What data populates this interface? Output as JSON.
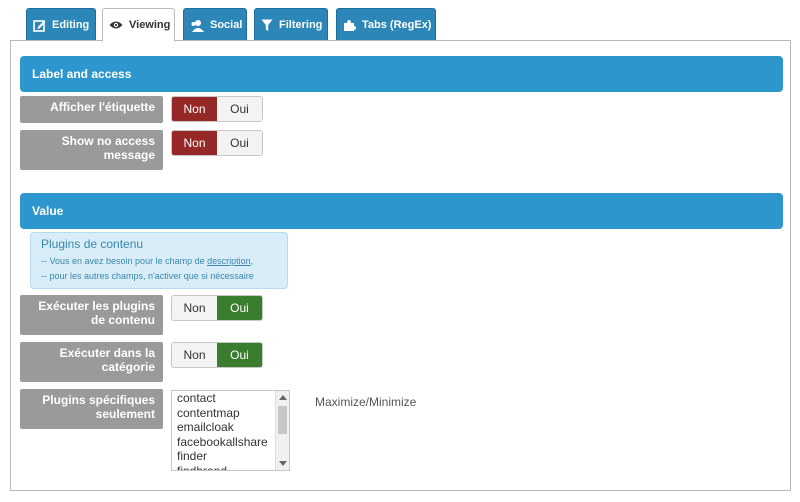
{
  "tabs": [
    {
      "label": "Editing",
      "icon": "edit-icon",
      "active": false
    },
    {
      "label": "Viewing",
      "icon": "eye-icon",
      "active": true
    },
    {
      "label": "Social",
      "icon": "users-icon",
      "active": false
    },
    {
      "label": "Filtering",
      "icon": "funnel-icon",
      "active": false
    },
    {
      "label": "Tabs (RegEx)",
      "icon": "puzzle-icon",
      "active": false
    }
  ],
  "sections": {
    "label_access": "Label and access",
    "value": "Value"
  },
  "fields": {
    "show_label": {
      "label": "Afficher l'étiquette",
      "no": "Non",
      "yes": "Oui",
      "selected": "Non"
    },
    "show_no_access": {
      "label": "Show no access message",
      "no": "Non",
      "yes": "Oui",
      "selected": "Non"
    },
    "run_plugins": {
      "label": "Exécuter les plugins de contenu",
      "no": "Non",
      "yes": "Oui",
      "selected": "Oui"
    },
    "run_in_category": {
      "label": "Exécuter dans la catégorie",
      "no": "Non",
      "yes": "Oui",
      "selected": "Oui"
    },
    "specific_plugins": {
      "label": "Plugins spécifiques seulement"
    }
  },
  "info": {
    "title": "Plugins de contenu",
    "line1_prefix": "-- Vous en avez besoin pour le champ de ",
    "line1_link": "description",
    "line1_suffix": ",",
    "line2": "-- pour les autres champs, n'activer que si nécessaire"
  },
  "plugins_list": [
    "contact",
    "contentmap",
    "emailcloak",
    "facebookallshare",
    "finder",
    "findbrand"
  ],
  "maximize_label": "Maximize/Minimize",
  "colors": {
    "tab_blue": "#2d86b8",
    "header_blue": "#2d96cc",
    "no_selected_red": "#962828",
    "yes_selected_green": "#3a7d2f",
    "label_gray": "#9a9a9a",
    "info_bg": "#d8edf8"
  }
}
